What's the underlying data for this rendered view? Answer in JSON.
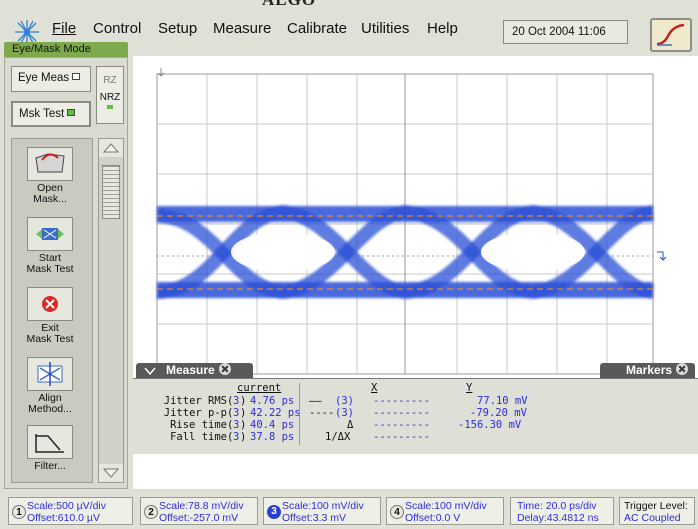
{
  "title_fragment": "ALGO",
  "menu": {
    "items": [
      {
        "label": "File"
      },
      {
        "label": "Control"
      },
      {
        "label": "Setup"
      },
      {
        "label": "Measure"
      },
      {
        "label": "Calibrate"
      },
      {
        "label": "Utilities"
      },
      {
        "label": "Help"
      }
    ],
    "datetime": "20 Oct 2004  11:06"
  },
  "left_panel": {
    "mode_tab": "Eye/Mask Mode",
    "eye_meas": "Eye Meas",
    "msk_test": "Msk Test",
    "rz": "RZ",
    "nrz": "NRZ",
    "tools": [
      {
        "line1": "Open",
        "line2": "Mask...",
        "icon": "open-folder-icon"
      },
      {
        "line1": "Start",
        "line2": "Mask Test",
        "icon": "start-mask-icon"
      },
      {
        "line1": "Exit",
        "line2": "Mask Test",
        "icon": "exit-mask-icon"
      },
      {
        "line1": "Align",
        "line2": "Method...",
        "icon": "align-icon"
      },
      {
        "line1": "Filter...",
        "line2": "",
        "icon": "filter-icon"
      }
    ]
  },
  "measure": {
    "tab_label": "Measure",
    "markers_label": "Markers",
    "col_current": "current",
    "col_x": "X",
    "col_y": "Y",
    "rows": [
      {
        "label": "Jitter RMS",
        "src": "3",
        "value": "4.76 ps"
      },
      {
        "label": "Jitter p-p",
        "src": "3",
        "value": "42.22 ps"
      },
      {
        "label": "Rise time",
        "src": "3",
        "value": "40.4 ps"
      },
      {
        "label": "Fall time",
        "src": "3",
        "value": "37.8 ps"
      }
    ],
    "markers": [
      {
        "prefix": "——",
        "src": "(3)",
        "x": "---------",
        "y": "77.10 mV"
      },
      {
        "prefix": "----",
        "src": "(3)",
        "x": "---------",
        "y": "-79.20 mV"
      },
      {
        "prefix": "Δ",
        "src": "",
        "x": "---------",
        "y": "-156.30 mV"
      },
      {
        "prefix": "1/ΔX",
        "src": "",
        "x": "---------",
        "y": ""
      }
    ]
  },
  "channels": [
    {
      "num": "1",
      "scale": "Scale:500 µV/div",
      "offset": "Offset:610.0 µV",
      "color": "#e9e9e0",
      "text": "#2d2dd9"
    },
    {
      "num": "2",
      "scale": "Scale:78.8 mV/div",
      "offset": "Offset:-257.0 mV",
      "color": "#e9e9e0",
      "text": "#2d2dd9"
    },
    {
      "num": "3",
      "scale": "Scale:100 mV/div",
      "offset": "Offset:3.3 mV",
      "color": "#2a3fd0",
      "text": "#2d2dd9"
    },
    {
      "num": "4",
      "scale": "Scale:100 mV/div",
      "offset": "Offset:0.0 V",
      "color": "#e9e9e0",
      "text": "#2d2dd9"
    }
  ],
  "timebase": {
    "time": "Time: 20.0 ps/div",
    "delay": "Delay:43.4812 ns"
  },
  "trigger": {
    "level": "Trigger Level:",
    "coupling": "AC Coupled"
  },
  "colors": {
    "trace": "#2a4fd6",
    "accent_green": "#7ea94d",
    "text_blue": "#2d2dd9"
  }
}
